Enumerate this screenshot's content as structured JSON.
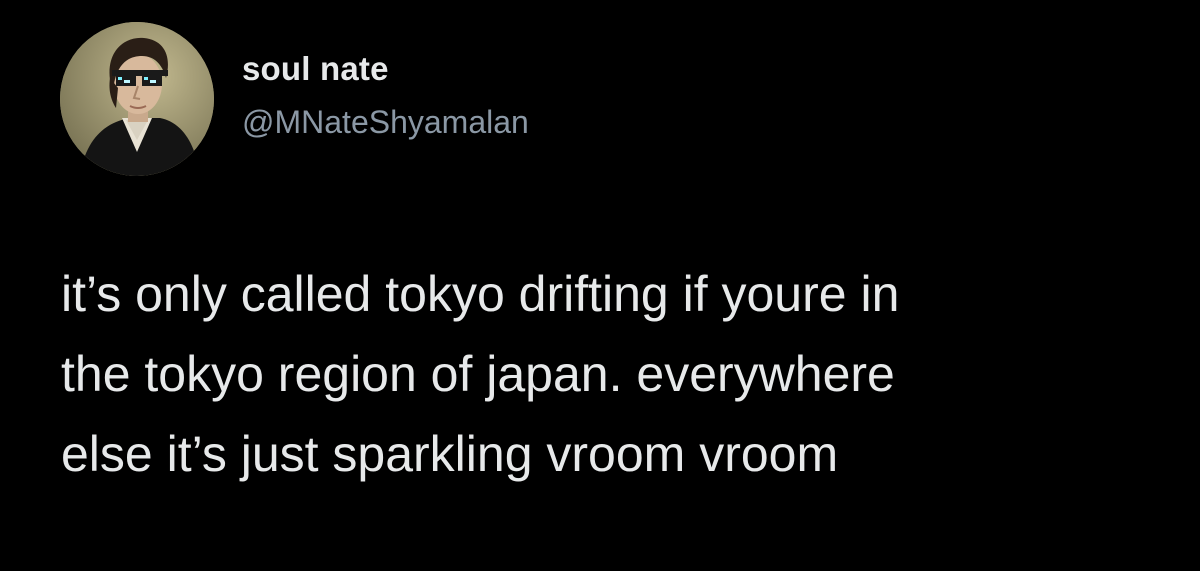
{
  "author": {
    "display_name": "soul nate",
    "handle": "@MNateShyamalan",
    "avatar": "portrait-with-pixel-sunglasses"
  },
  "tweet": {
    "lines": [
      "it’s only called tokyo drifting if youre in",
      "the tokyo region of japan. everywhere",
      "else it’s just sparkling vroom vroom"
    ]
  },
  "colors": {
    "background": "#000000",
    "primary_text": "#e7e9ea",
    "secondary_text": "#8b98a5"
  }
}
